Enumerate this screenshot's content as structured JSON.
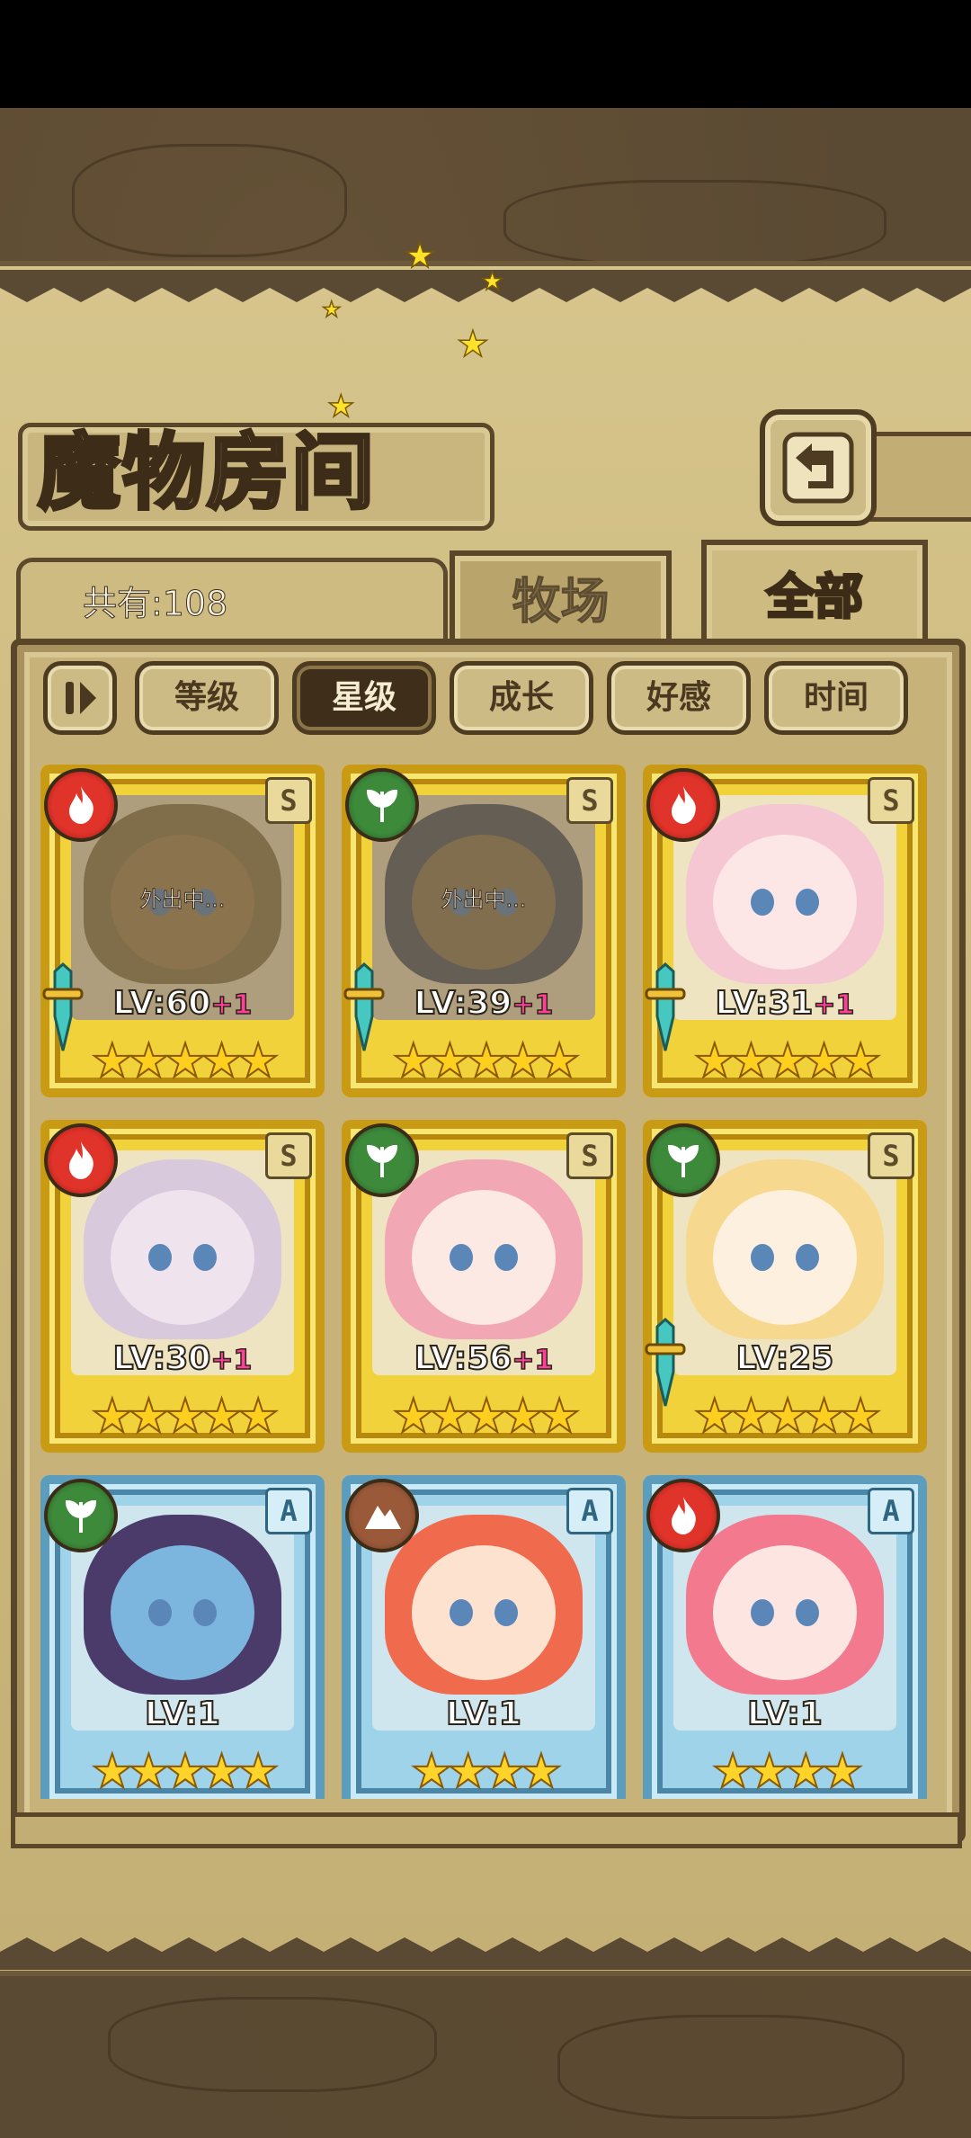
{
  "screen": {
    "title": "魔物房间",
    "count_label": "共有:108",
    "tabs": [
      {
        "label": "牧场",
        "active": false
      },
      {
        "label": "全部",
        "active": true
      }
    ],
    "sort_buttons": [
      {
        "label": "等级",
        "active": false
      },
      {
        "label": "星级",
        "active": true
      },
      {
        "label": "成长",
        "active": false
      },
      {
        "label": "好感",
        "active": false
      },
      {
        "label": "时间",
        "active": false
      }
    ],
    "icons": {
      "back": "return-arrow-icon",
      "sort_toggle": "sort-order-icon"
    }
  },
  "monsters": [
    {
      "element": "fire",
      "rank": "S",
      "level": "LV:60",
      "bonus": "+1",
      "stars": "★★★★★",
      "status": "外出中...",
      "away": true,
      "has_weapon": true,
      "frame": "gold",
      "skin": "#a08558",
      "hair": "#8a7a52"
    },
    {
      "element": "leaf",
      "rank": "S",
      "level": "LV:39",
      "bonus": "+1",
      "stars": "★★★★★",
      "status": "外出中...",
      "away": true,
      "has_weapon": true,
      "frame": "gold",
      "skin": "#8c7a5c",
      "hair": "#4f5866"
    },
    {
      "element": "fire",
      "rank": "S",
      "level": "LV:31",
      "bonus": "+1",
      "stars": "★★★★★",
      "status": "",
      "away": false,
      "has_weapon": true,
      "frame": "gold",
      "skin": "#fde6e6",
      "hair": "#f4c7d3"
    },
    {
      "element": "fire",
      "rank": "S",
      "level": "LV:30",
      "bonus": "+1",
      "stars": "★★★★★",
      "status": "",
      "away": false,
      "has_weapon": false,
      "frame": "gold",
      "skin": "#efe4ee",
      "hair": "#d9c9dc"
    },
    {
      "element": "leaf",
      "rank": "S",
      "level": "LV:56",
      "bonus": "+1",
      "stars": "★★★★★",
      "status": "",
      "away": false,
      "has_weapon": false,
      "frame": "gold",
      "skin": "#fde9e4",
      "hair": "#f2a7b4"
    },
    {
      "element": "leaf",
      "rank": "S",
      "level": "LV:25",
      "bonus": "",
      "stars": "★★★★★",
      "status": "",
      "away": false,
      "has_weapon": true,
      "frame": "gold",
      "skin": "#fdf0df",
      "hair": "#f6d98e"
    },
    {
      "element": "leaf",
      "rank": "A",
      "level": "LV:1",
      "bonus": "",
      "stars": "★★★★★",
      "status": "",
      "away": false,
      "has_weapon": false,
      "frame": "blue",
      "skin": "#7cb6de",
      "hair": "#4a3b6b"
    },
    {
      "element": "earth",
      "rank": "A",
      "level": "LV:1",
      "bonus": "",
      "stars": "★★★★",
      "status": "",
      "away": false,
      "has_weapon": false,
      "frame": "blue",
      "skin": "#fde2cf",
      "hair": "#f06a4e"
    },
    {
      "element": "fire",
      "rank": "A",
      "level": "LV:1",
      "bonus": "",
      "stars": "★★★★",
      "status": "",
      "away": false,
      "has_weapon": false,
      "frame": "blue",
      "skin": "#fde6e2",
      "hair": "#f37a8e"
    }
  ],
  "colors": {
    "fire": "#e0332a",
    "leaf": "#3d8a3b",
    "earth": "#9a5a3a",
    "gold_frame": "#f2d23a",
    "blue_frame": "#9fd3ea",
    "bonus": "#ff3f9a"
  }
}
